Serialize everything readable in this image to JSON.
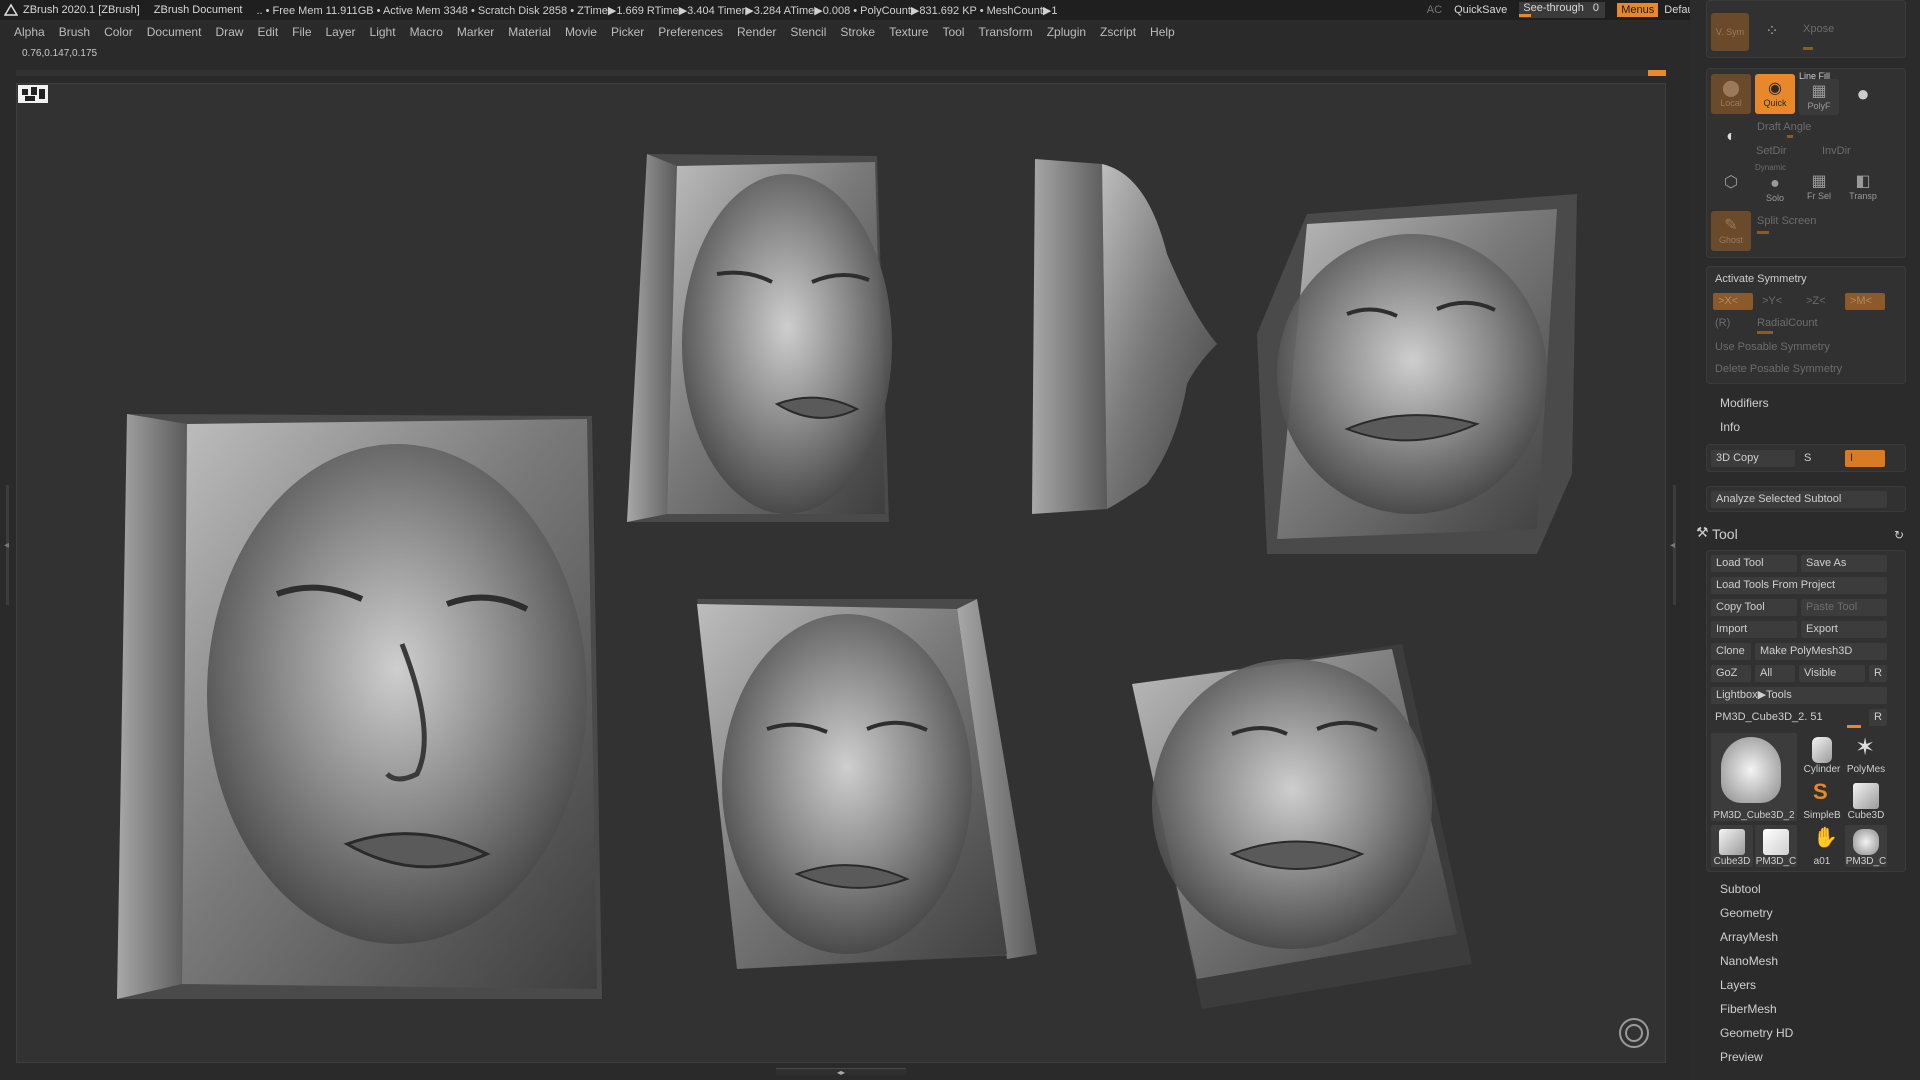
{
  "titlebar": {
    "app": "ZBrush 2020.1 [ZBrush]",
    "document": "ZBrush Document",
    "stats": ".. • Free Mem 11.911GB • Active Mem 3348 • Scratch Disk 2858 •  ZTime▶1.669 RTime▶3.404 Timer▶3.284 ATime▶0.008 • PolyCount▶831.692 KP  • MeshCount▶1",
    "ac": "AC",
    "quicksave": "QuickSave",
    "see_through_label": "See-through",
    "see_through_value": "0",
    "menus": "Menus",
    "default_zscript": "DefaultZScript"
  },
  "menubar": [
    "Alpha",
    "Brush",
    "Color",
    "Document",
    "Draw",
    "Edit",
    "File",
    "Layer",
    "Light",
    "Macro",
    "Marker",
    "Material",
    "Movie",
    "Picker",
    "Preferences",
    "Render",
    "Stencil",
    "Stroke",
    "Texture",
    "Tool",
    "Transform",
    "Zplugin",
    "Zscript",
    "Help"
  ],
  "coords": "0.76,0.147,0.175",
  "right_panel": {
    "top_icons": [
      "Local",
      "Quick",
      "PolyF",
      "Solo",
      "Fr Sel",
      "Transp",
      "Ghost"
    ],
    "line_fill": "Line Fill",
    "draft_angle": "Draft Angle",
    "setdir": "SetDir",
    "invdir": "InvDir",
    "dynamic": "Dynamic",
    "split_screen": "Split Screen",
    "xpose": "Xpose",
    "v_sym": "V. Sym",
    "symmetry": {
      "activate": "Activate Symmetry",
      "axes": [
        ">X<",
        ">Y<",
        ">Z<",
        ">M<"
      ],
      "r": "(R)",
      "radial": "RadialCount",
      "posable": "Use Posable Symmetry",
      "delete_posable": "Delete Posable Symmetry"
    },
    "modifiers": "Modifiers",
    "info": "Info",
    "copy3d": {
      "label": "3D Copy",
      "s": "S",
      "i": "I"
    },
    "analyze": "Analyze Selected Subtool",
    "tool_title": "Tool",
    "tool_buttons": {
      "load_tool": "Load Tool",
      "save_as": "Save As",
      "load_from_project": "Load Tools From Project",
      "copy_tool": "Copy Tool",
      "paste_tool": "Paste Tool",
      "import": "Import",
      "export": "Export",
      "clone": "Clone",
      "make_polymesh": "Make PolyMesh3D",
      "goz": "GoZ",
      "all": "All",
      "visible": "Visible",
      "r": "R",
      "lightbox": "Lightbox▶Tools",
      "current_tool": "PM3D_Cube3D_2. 51",
      "current_tool_r": "R"
    },
    "thumbs": [
      "PM3D_Cube3D_2",
      "Cylinder",
      "PolyMes",
      "SimpleB",
      "Cube3D",
      "Cube3D",
      "PM3D_C",
      "a01",
      "PM3D_C"
    ],
    "submenus": [
      "Subtool",
      "Geometry",
      "ArrayMesh",
      "NanoMesh",
      "Layers",
      "FiberMesh",
      "Geometry HD",
      "Preview"
    ]
  }
}
